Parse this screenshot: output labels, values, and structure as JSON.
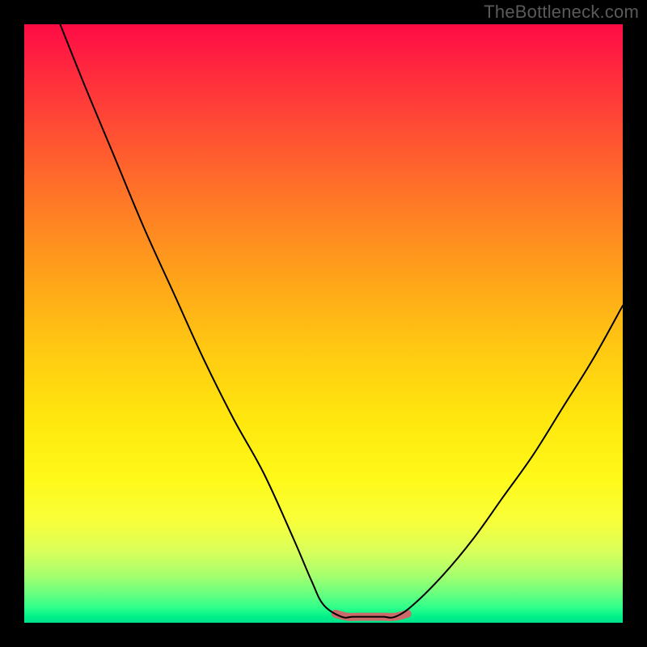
{
  "watermark": "TheBottleneck.com",
  "colors": {
    "background": "#000000",
    "curve": "#000000",
    "optimal_marker": "#cb6a68",
    "gradient_top": "#ff0b45",
    "gradient_mid": "#ffe70e",
    "gradient_bottom": "#00e28a"
  },
  "chart_data": {
    "type": "line",
    "title": "",
    "xlabel": "",
    "ylabel": "",
    "xlim": [
      0,
      100
    ],
    "ylim": [
      0,
      100
    ],
    "grid": false,
    "legend": false,
    "series": [
      {
        "name": "bottleneck-curve",
        "x": [
          6,
          10,
          15,
          20,
          25,
          30,
          35,
          40,
          45,
          48,
          50,
          53,
          55,
          58,
          60,
          62,
          65,
          70,
          75,
          80,
          85,
          90,
          95,
          100
        ],
        "y": [
          100,
          90,
          78,
          66,
          55,
          44,
          34,
          25,
          14,
          7,
          3,
          1,
          1,
          1,
          1,
          1,
          3,
          8,
          14,
          21,
          28,
          36,
          44,
          53
        ]
      },
      {
        "name": "optimal-range-marker",
        "x": [
          52,
          54,
          56,
          58,
          60,
          62,
          64
        ],
        "y": [
          1.5,
          1,
          1,
          1,
          1,
          1,
          1.5
        ]
      }
    ],
    "annotations": []
  }
}
